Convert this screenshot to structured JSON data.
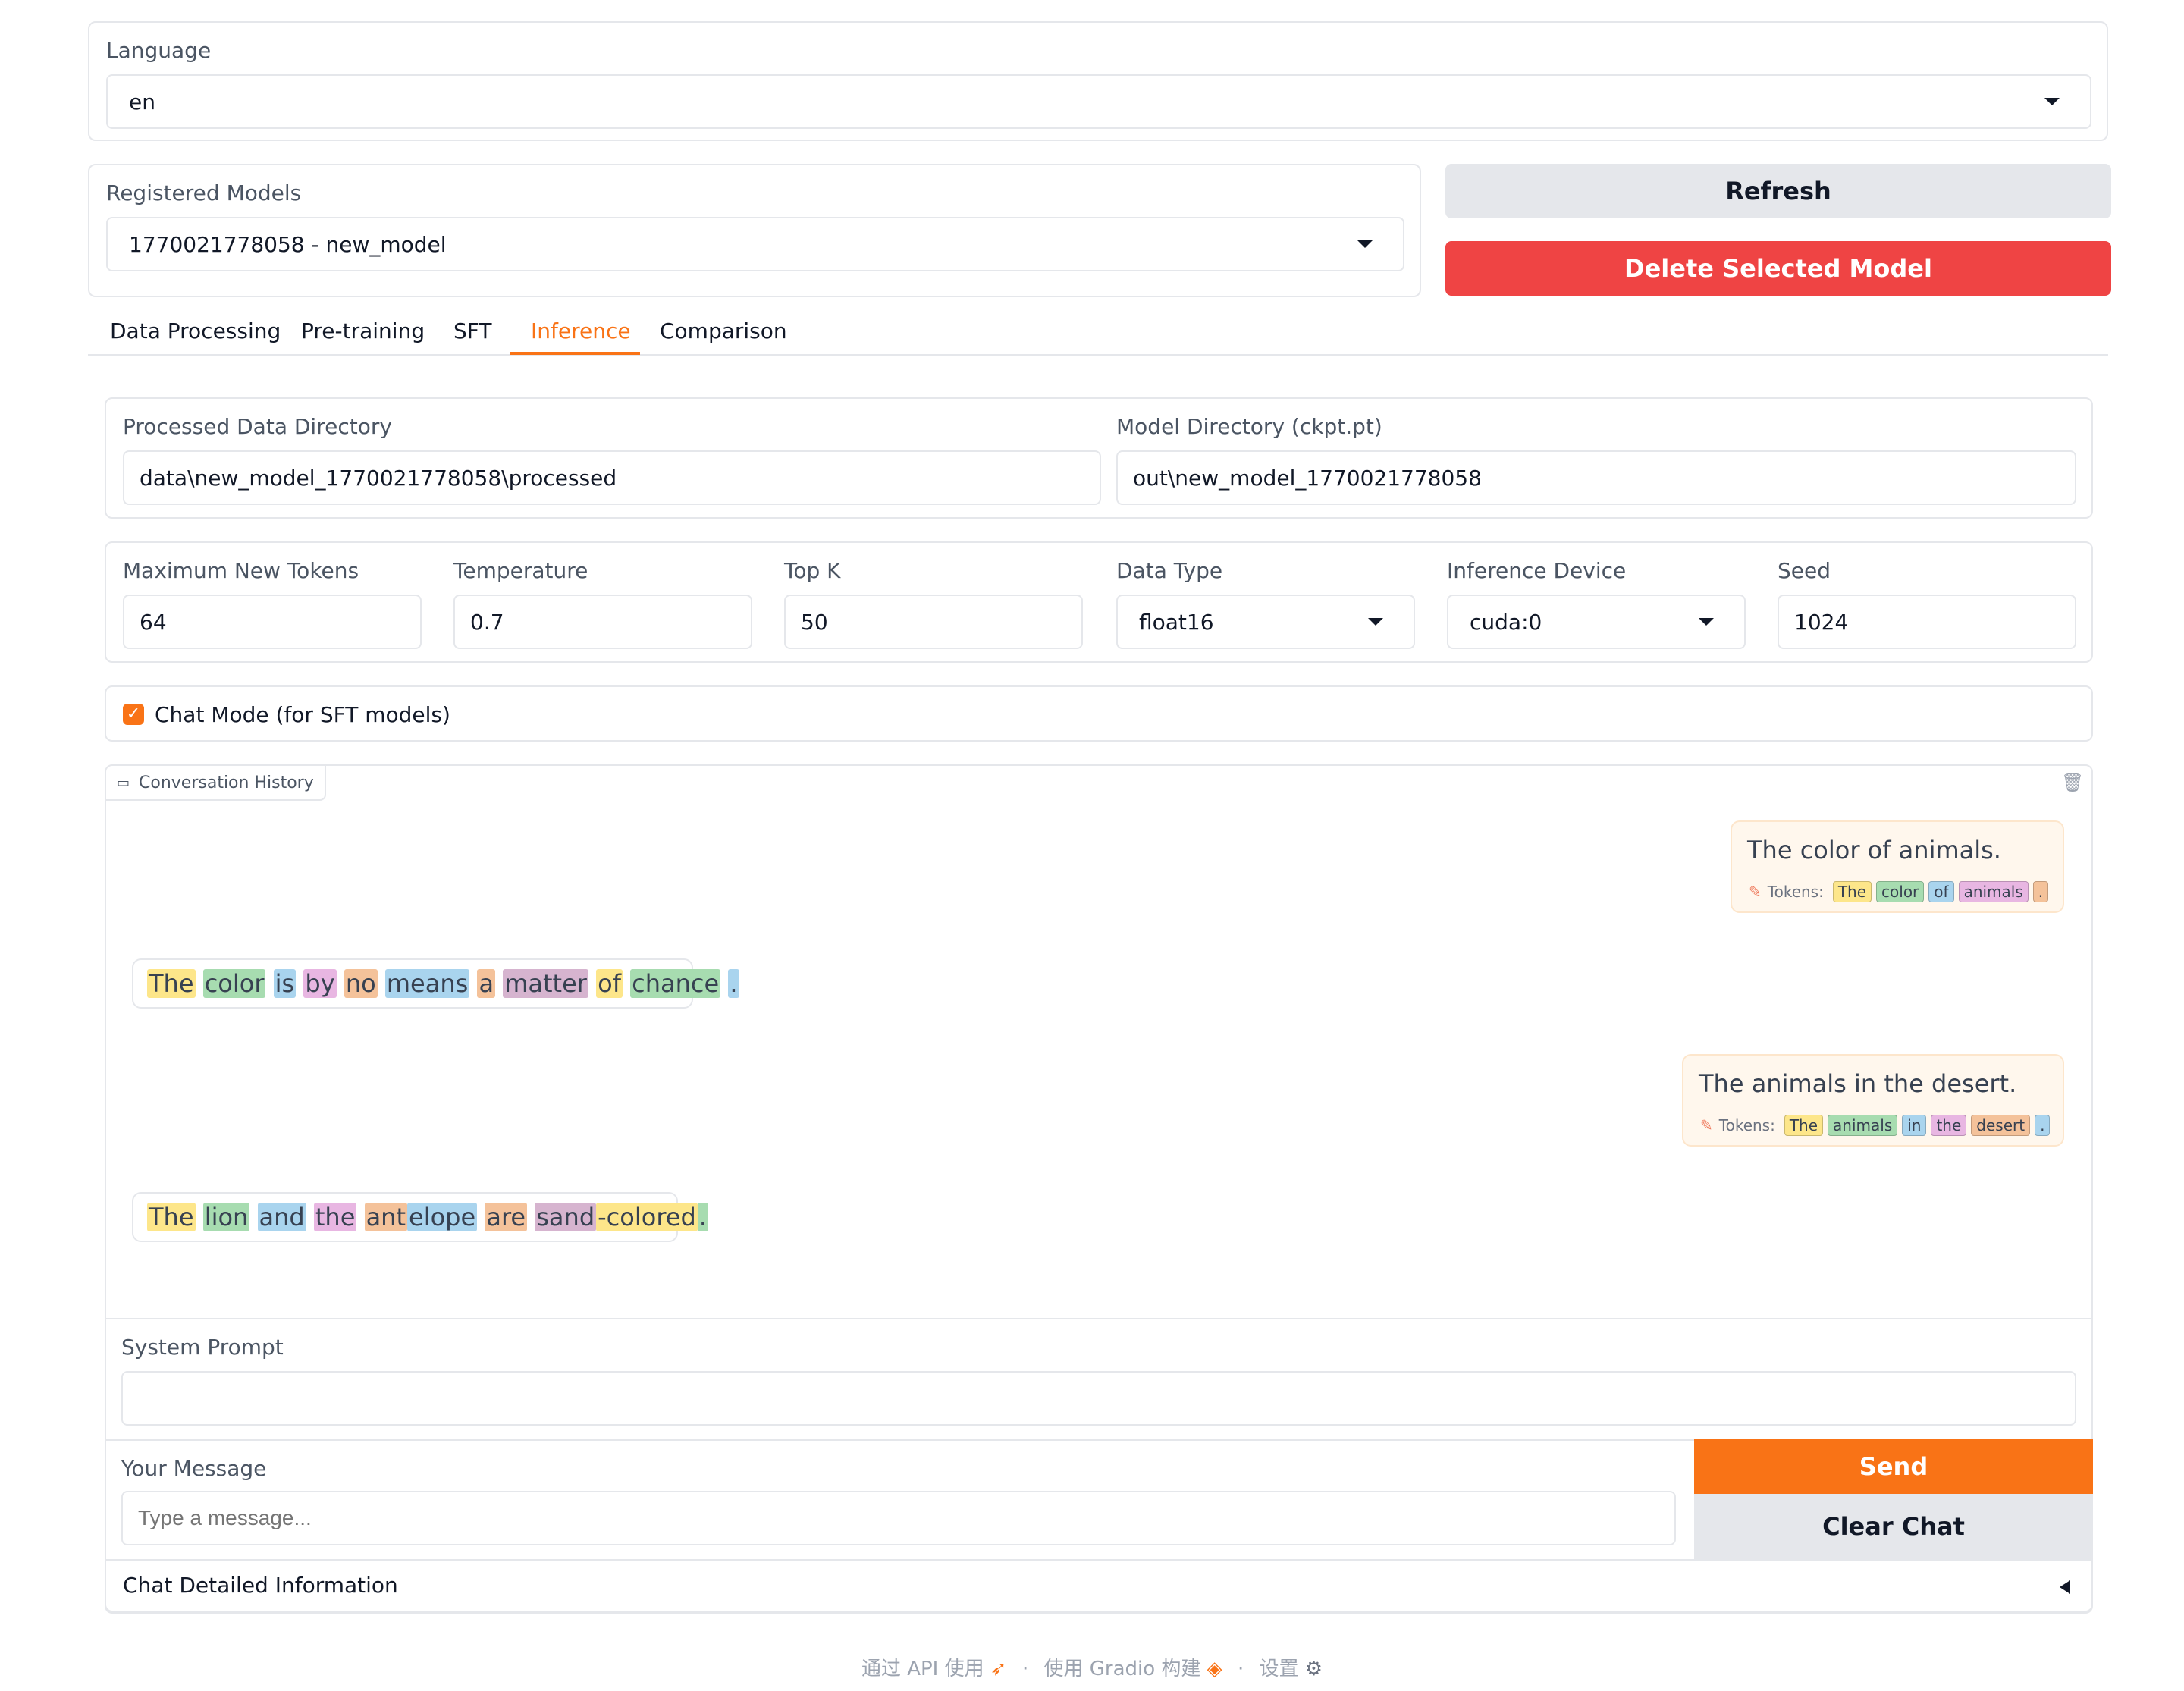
{
  "language": {
    "label": "Language",
    "value": "en"
  },
  "models": {
    "label": "Registered Models",
    "value": "1770021778058 - new_model",
    "refresh_label": "Refresh",
    "delete_label": "Delete Selected Model"
  },
  "tabs": [
    {
      "label": "Data Processing"
    },
    {
      "label": "Pre-training"
    },
    {
      "label": "SFT"
    },
    {
      "label": "Inference",
      "active": true
    },
    {
      "label": "Comparison"
    }
  ],
  "dirs": {
    "processed_label": "Processed Data Directory",
    "processed_value": "data\\new_model_1770021778058\\processed",
    "model_label": "Model Directory (ckpt.pt)",
    "model_value": "out\\new_model_1770021778058"
  },
  "params": {
    "max_tokens": {
      "label": "Maximum New Tokens",
      "value": "64"
    },
    "temperature": {
      "label": "Temperature",
      "value": "0.7"
    },
    "top_k": {
      "label": "Top K",
      "value": "50"
    },
    "dtype": {
      "label": "Data Type",
      "value": "float16"
    },
    "device": {
      "label": "Inference Device",
      "value": "cuda:0"
    },
    "seed": {
      "label": "Seed",
      "value": "1024"
    }
  },
  "chat_mode": {
    "label": "Chat Mode (for SFT models)",
    "checked": true
  },
  "history": {
    "label": "Conversation History",
    "tokens_label": "Tokens:",
    "messages": [
      {
        "role": "user",
        "text": "The color of animals.",
        "tokens": [
          "The",
          "color",
          "of",
          "animals",
          "."
        ]
      },
      {
        "role": "bot",
        "tokens": [
          "The",
          "color",
          "is",
          "by",
          "no",
          "means",
          "a",
          "matter",
          "of",
          "chance",
          "."
        ]
      },
      {
        "role": "user",
        "text": "The animals in the desert.",
        "tokens": [
          "The",
          "animals",
          "in",
          "the",
          "desert",
          "."
        ]
      },
      {
        "role": "bot",
        "tokens": [
          "The",
          "lion",
          "and",
          "the",
          "ant",
          "elope",
          "are",
          "sand",
          "-colored",
          "."
        ]
      }
    ]
  },
  "system_prompt": {
    "label": "System Prompt",
    "value": ""
  },
  "message": {
    "label": "Your Message",
    "placeholder": "Type a message...",
    "send_label": "Send",
    "clear_label": "Clear Chat"
  },
  "details": {
    "label": "Chat Detailed Information"
  },
  "footer": {
    "api": "通过 API 使用",
    "built": "使用 Gradio 构建",
    "settings": "设置",
    "sep": "·"
  },
  "colors": {
    "accent": "#f97316",
    "danger": "#ef4444",
    "neutral_button": "#e5e7eb"
  }
}
